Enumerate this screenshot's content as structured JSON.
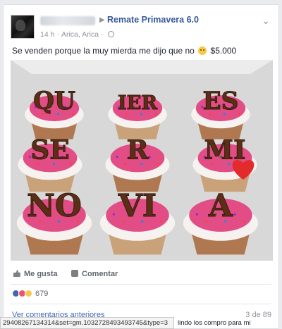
{
  "post": {
    "group_name": "Remate Primavera 6.0",
    "time": "14 h",
    "location": "Arica, Arica",
    "text_before_emoji": "Se venden porque la muy mierda me dijo que no",
    "text_after_emoji": "$5.000",
    "emoji": "grimacing-emoji",
    "photo": {
      "description_icons": [
        "cupcake-icon"
      ],
      "cupcake_letters": [
        [
          "QU",
          "IER",
          "ES"
        ],
        [
          "SE",
          "R",
          "MI"
        ],
        [
          "NO",
          "VI",
          "A"
        ]
      ],
      "heart": "heart-candy"
    }
  },
  "actions": {
    "like_label": "Me gusta",
    "comment_label": "Comentar"
  },
  "reactions": {
    "count": "679",
    "types": [
      "like",
      "love",
      "wow"
    ]
  },
  "comments": {
    "view_previous_label": "Ver comentarios anteriores",
    "count_label": "3 de 89",
    "snippet": "lindo los compro para mi"
  },
  "status_url": "29408267134314&set=gm.1032728493493745&type=3",
  "colors": {
    "link_blue": "#365899",
    "frosting_pink": "#e24d86",
    "chocolate": "#5a2e17"
  }
}
